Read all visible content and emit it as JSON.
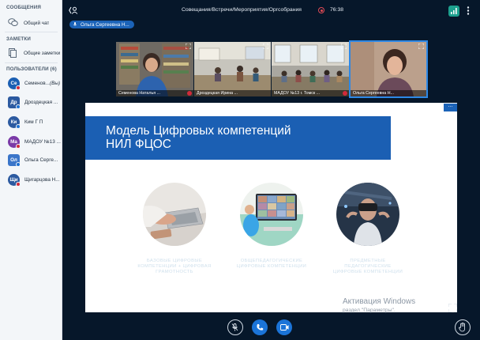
{
  "sidebar": {
    "messages_title": "СООБЩЕНИЯ",
    "public_chat": "Общий чат",
    "notes_title": "ЗАМЕТКИ",
    "shared_notes": "Общие заметки",
    "users_title": "ПОЛЬЗОВАТЕЛИ (6)",
    "users": [
      {
        "initials": "Се",
        "name": "Семенов...",
        "suffix": "(Вы)",
        "color": "#1b5fb3",
        "status": "red"
      },
      {
        "initials": "Др",
        "name": "Дроздецкая ...",
        "suffix": "",
        "color": "#2c5aa0",
        "status": "blue"
      },
      {
        "initials": "Ки",
        "name": "Ким Г П",
        "suffix": "",
        "color": "#2c5aa0",
        "status": "blue"
      },
      {
        "initials": "Ма",
        "name": "МАДОУ №13 ...",
        "suffix": "",
        "color": "#7a3aa7",
        "status": "red"
      },
      {
        "initials": "Ол",
        "name": "Ольга Серге...",
        "suffix": "",
        "color": "#3a75c9",
        "status": "blue"
      },
      {
        "initials": "Щи",
        "name": "Щигарцова Н...",
        "suffix": "",
        "color": "#2c5aa0",
        "status": "red"
      }
    ]
  },
  "topbar": {
    "title": "Совещания/Встречи/Мероприятия/Оргсобрания",
    "timer": "76:38"
  },
  "presenter": "Ольга Сергеевна Н...",
  "videos": [
    {
      "caption": "Семенова Наталья ...",
      "active": false
    },
    {
      "caption": "Дроздецкая Ирина ...",
      "active": false
    },
    {
      "caption": "МАДОУ №13 г. Томск ...",
      "active": false
    },
    {
      "caption": "Ольга Сергеевна Н...",
      "active": true
    }
  ],
  "slide": {
    "title_line1": "Модель Цифровых компетенций",
    "title_line2": "НИЛ ФЦОС",
    "captions": [
      {
        "l1": "БАЗОВЫЕ ЦИФРОВЫЕ",
        "l2": "КОМПЕТЕНЦИИ + ЦИФРОВАЯ",
        "l3": "ГРАМОТНОСТЬ"
      },
      {
        "l1": "ОБЩЕПЕДАГОГИЧЕСКИЕ",
        "l2": "ЦИФРОВЫЕ КОМПЕТЕНЦИИ",
        "l3": ""
      },
      {
        "l1": "ПРЕДМЕТНЫЕ",
        "l2": "ПЕДАГОГИЧЕСКИЕ",
        "l3": "ЦИФРОВЫЕ КОМПЕТЕНЦИИ"
      }
    ],
    "menu_button": "..."
  },
  "watermark": {
    "line1": "Активация Windows",
    "line2": "раздел \"Параметры\"."
  },
  "colors": {
    "background": "#06172a",
    "accent": "#1b74d8",
    "slide_band": "#1b5fb3"
  }
}
